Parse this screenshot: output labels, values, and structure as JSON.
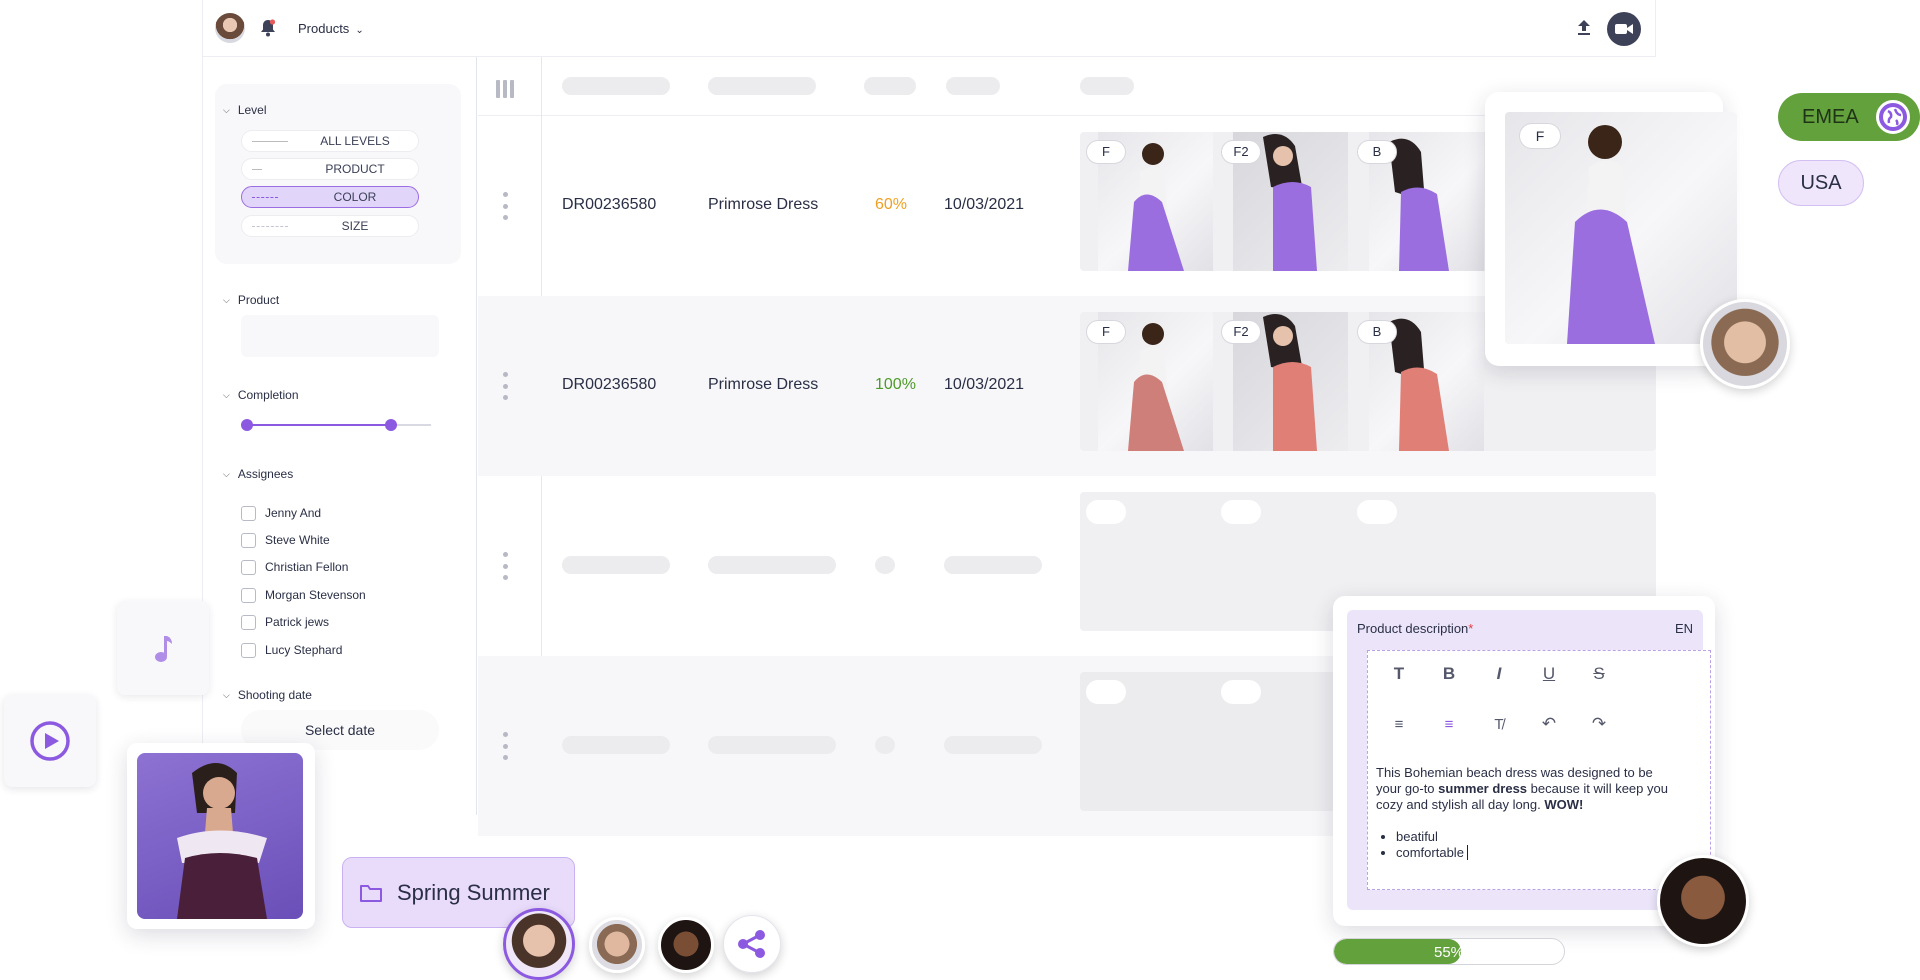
{
  "header": {
    "products_label": "Products"
  },
  "sidebar": {
    "level_title": "Level",
    "levels": [
      {
        "label": "ALL LEVELS",
        "active": false
      },
      {
        "label": "PRODUCT",
        "active": false
      },
      {
        "label": "COLOR",
        "active": true
      },
      {
        "label": "SIZE",
        "active": false
      }
    ],
    "product_title": "Product",
    "completion_title": "Completion",
    "assignees_title": "Assignees",
    "assignees": [
      "Jenny And",
      "Steve White",
      "Christian Fellon",
      "Morgan Stevenson",
      "Patrick jews",
      "Lucy Stephard"
    ],
    "shooting_title": "Shooting date",
    "select_date": "Select date"
  },
  "table": {
    "rows": [
      {
        "sku": "DR00236580",
        "name": "Primrose Dress",
        "completion": "60%",
        "date": "10/03/2021",
        "tags": [
          "F",
          "F2",
          "B"
        ],
        "garment_color": "#9b6ee0"
      },
      {
        "sku": "DR00236580",
        "name": "Primrose Dress",
        "completion": "100%",
        "date": "10/03/2021",
        "tags": [
          "F",
          "F2",
          "B"
        ],
        "garment_color": "#e07f76"
      }
    ]
  },
  "preview": {
    "tag": "F"
  },
  "regions": {
    "emea": "EMEA",
    "usa": "USA"
  },
  "editor": {
    "title": "Product description",
    "required_mark": "*",
    "lang": "EN",
    "text_a": "This Bohemian beach dress was designed to be your go-to ",
    "text_bold": "summer dress",
    "text_b": " because it will keep you cozy and stylish all day long. ",
    "text_wow": "WOW!",
    "bullets": [
      "beatiful",
      "comfortable"
    ]
  },
  "progress": {
    "label": "55%",
    "value": 0.55
  },
  "folder": {
    "label": "Spring Summer"
  },
  "colors": {
    "accent": "#8c5ae0",
    "green": "#63a13c",
    "orange": "#f0a020"
  }
}
